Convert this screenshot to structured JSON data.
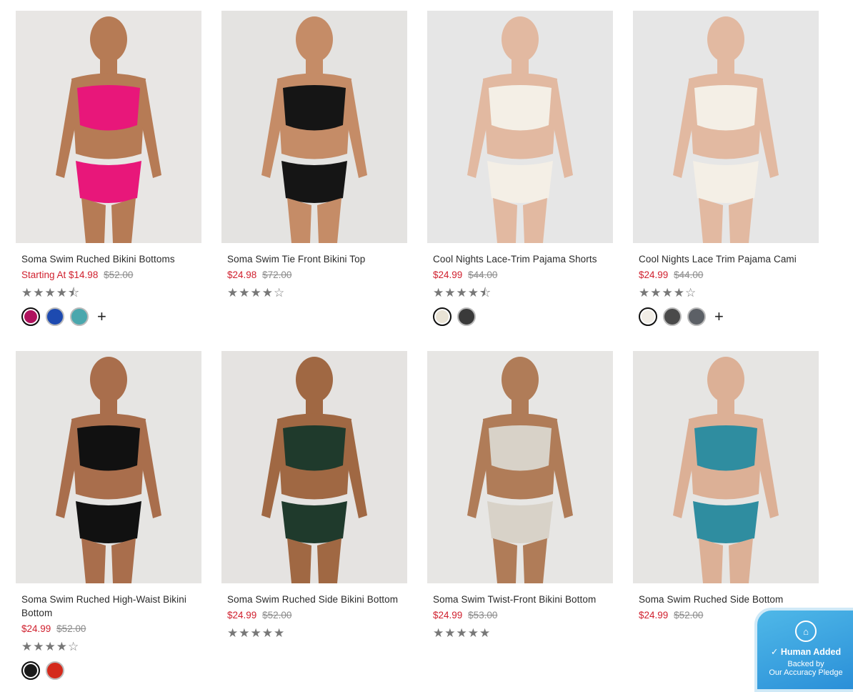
{
  "products": [
    {
      "name": "Soma Swim Ruched Bikini Bottoms",
      "price": "Starting At $14.98",
      "original_price": "$52.00",
      "rating": 4.5,
      "stars": "★★★★⯪",
      "swatches": [
        "#b0125e",
        "#1d4ab0",
        "#4aa7ad"
      ],
      "more_colors": "+",
      "image_colors": {
        "bg": "#e8e6e4",
        "garment": "#e8177a",
        "skin": "#b67b55"
      }
    },
    {
      "name": "Soma Swim Tie Front Bikini Top",
      "price": "$24.98",
      "original_price": "$72.00",
      "rating": 4,
      "stars": "★★★★☆",
      "swatches": [],
      "more_colors": "",
      "image_colors": {
        "bg": "#e4e3e1",
        "garment": "#151515",
        "skin": "#c58c67"
      }
    },
    {
      "name": "Cool Nights Lace-Trim Pajama Shorts",
      "price": "$24.99",
      "original_price": "$44.00",
      "rating": 4.5,
      "stars": "★★★★⯪",
      "swatches": [
        "#e9e3d5",
        "#3a3a3a"
      ],
      "more_colors": "",
      "image_colors": {
        "bg": "#e6e6e6",
        "garment": "#f4efe6",
        "skin": "#e2b9a1"
      }
    },
    {
      "name": "Cool Nights Lace Trim Pajama Cami",
      "price": "$24.99",
      "original_price": "$44.00",
      "rating": 4,
      "stars": "★★★★☆",
      "swatches": [
        "#f1ede6",
        "#4a4a4a",
        "#5c6066"
      ],
      "more_colors": "+",
      "image_colors": {
        "bg": "#e6e6e6",
        "garment": "#f4efe6",
        "skin": "#e2b9a1"
      }
    },
    {
      "name": "Soma Swim Ruched High-Waist Bikini Bottom",
      "price": "$24.99",
      "original_price": "$52.00",
      "rating": 4,
      "stars": "★★★★☆",
      "swatches": [
        "#1a1a1a",
        "#d42a1c"
      ],
      "more_colors": "",
      "image_colors": {
        "bg": "#e6e5e3",
        "garment": "#111111",
        "skin": "#a96e4c"
      }
    },
    {
      "name": "Soma Swim Ruched Side Bikini Bottom",
      "price": "$24.99",
      "original_price": "$52.00",
      "rating": 5,
      "stars": "★★★★★",
      "swatches": [],
      "more_colors": "",
      "image_colors": {
        "bg": "#e5e3e1",
        "garment": "#1f3a2c",
        "skin": "#a06843"
      }
    },
    {
      "name": "Soma Swim Twist-Front Bikini Bottom",
      "price": "$24.99",
      "original_price": "$53.00",
      "rating": 5,
      "stars": "★★★★★",
      "swatches": [],
      "more_colors": "",
      "image_colors": {
        "bg": "#e7e6e4",
        "garment": "#d8d2c8",
        "skin": "#b07c58"
      }
    },
    {
      "name": "Soma Swim Ruched Side Bottom",
      "price": "$24.99",
      "original_price": "$52.00",
      "rating": null,
      "stars": "",
      "swatches": [],
      "more_colors": "",
      "image_colors": {
        "bg": "#e6e5e3",
        "garment": "#2f8da0",
        "skin": "#dcb096"
      }
    }
  ],
  "pledge": {
    "icon": "house-icon",
    "title": "Human Added",
    "subtitle_line1": "Backed by",
    "subtitle_line2": "Our Accuracy Pledge",
    "accent": "#3aa5e3"
  },
  "colors": {
    "sale": "#d0202e",
    "strike": "#8a8a8a",
    "star": "#777777"
  }
}
